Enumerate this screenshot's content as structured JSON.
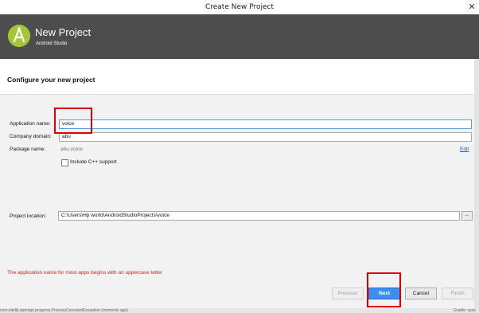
{
  "window": {
    "title": "Create New Project"
  },
  "header": {
    "title": "New Project",
    "subtitle": "Android Studio"
  },
  "section": {
    "title": "Configure your new project"
  },
  "form": {
    "app_name_label": "Application name:",
    "app_name_value": "voice",
    "company_domain_label": "Company domain:",
    "company_domain_value": "abu",
    "package_name_label": "Package name:",
    "package_name_value": "abu.voice",
    "edit_label": "Edit",
    "include_cpp_label": "Include C++ support",
    "include_cpp_checked": false,
    "project_location_label": "Project location:",
    "project_location_value": "C:\\Users\\Hp world\\AndroidStudioProjects\\voice",
    "browse_label": "..."
  },
  "messages": {
    "error": "The application name for most apps begins with an uppercase letter"
  },
  "buttons": {
    "previous": "Previous",
    "next": "Next",
    "cancel": "Cancel",
    "finish": "Finish"
  },
  "status": {
    "text": "com.intellij.openapi.progress.ProcessCanceledException (moments ago)",
    "right": "Gradle: sync"
  },
  "colors": {
    "header_bg": "#4d4d4d",
    "accent_blue": "#3d8ef0",
    "error_red": "#e02020",
    "highlight_red": "#e00000",
    "logo_green": "#a4c639"
  }
}
